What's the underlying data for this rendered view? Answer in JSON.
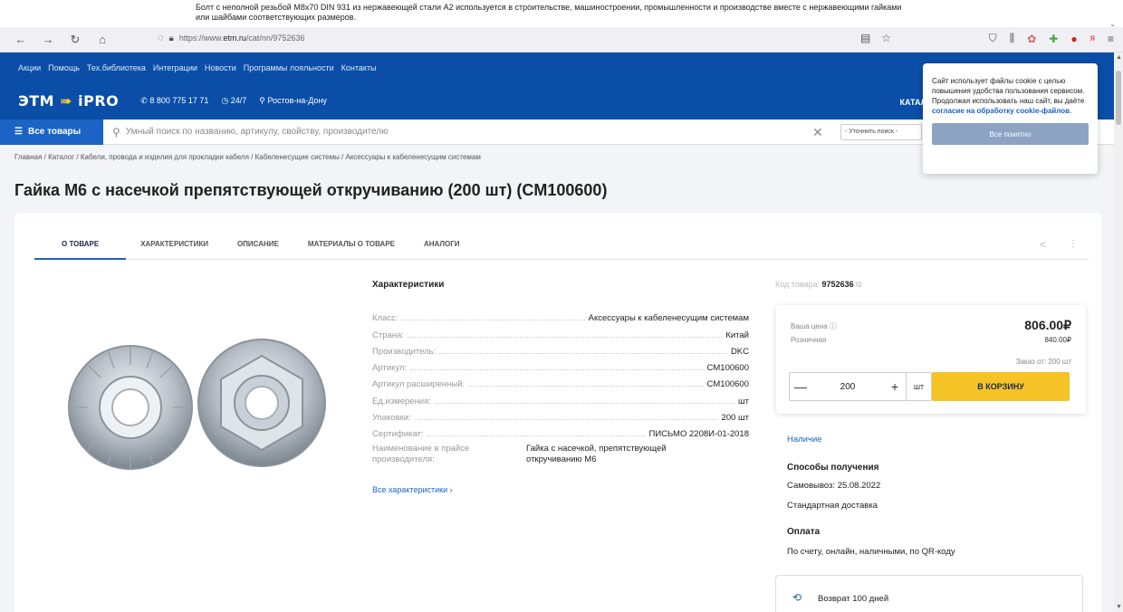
{
  "tooltip": {
    "line1": "Болт с неполной резьбой М8х70 DIN 931 из нержавеющей стали А2 используется в строительстве, машиностроении, промышленности и производстве вместе с нержавеющими гайками",
    "line2": "или шайбами соответствующих размеров."
  },
  "browser": {
    "url_prefix": "https://www.",
    "url_domain": "etm.ru",
    "url_path": "/cat/nn/9752636"
  },
  "topnav": {
    "links": [
      "Акции",
      "Помощь",
      "Тех.библиотека",
      "Интеграции",
      "Новости",
      "Программы лояльности",
      "Контакты"
    ]
  },
  "header": {
    "logo_a": "ЭТМ",
    "logo_b": "iPRO",
    "phone": "8 800 775 17 71",
    "hours": "24/7",
    "city": "Ростов-на-Дону",
    "catalog": "КАТАЛОГ"
  },
  "search": {
    "all_goods": "Все товары",
    "placeholder": "Умный поиск по названию, артикулу, свойству, производителю",
    "refine": "- Уточнить поиск -"
  },
  "cookie": {
    "text": "Сайт использует файлы cookie с целью повышения удобства пользования сервисом. Продолжая использовать наш сайт, вы даёте",
    "link": "согласие на обработку cookie-файлов",
    "dot": ".",
    "button": "Все понятно"
  },
  "breadcrumb": "Главная  /  Каталог  /  Кабели, провода и изделия для прокладки кабеля  /  Кабеленесущие системы  /  Аксессуары к кабеленесущим системам",
  "title": "Гайка М6 с насечкой препятствующей откручиванию (200 шт) (CM100600)",
  "tabs": [
    "О ТОВАРЕ",
    "ХАРАКТЕРИСТИКИ",
    "ОПИСАНИЕ",
    "МАТЕРИАЛЫ О ТОВАРЕ",
    "АНАЛОГИ"
  ],
  "specs": {
    "heading": "Характеристики",
    "rows": [
      {
        "k": "Класс:",
        "v": "Аксессуары к кабеленесущим системам"
      },
      {
        "k": "Страна:",
        "v": "Китай"
      },
      {
        "k": "Производитель:",
        "v": "DKC"
      },
      {
        "k": "Артикул:",
        "v": "CM100600"
      },
      {
        "k": "Артикул расширенный:",
        "v": "CM100600"
      },
      {
        "k": "Ед.измерения:",
        "v": "шт"
      },
      {
        "k": "Упаковки:",
        "v": "200 шт"
      },
      {
        "k": "Сертификат:",
        "v": "ПИСЬМО 2208И-01-2018"
      }
    ],
    "vendor_name_k": "Наименование в прайсе производителя:",
    "vendor_name_v": "Гайка с насечкой, препятствующей откручиванию М6",
    "all_link": "Все характеристики"
  },
  "product": {
    "code_label": "Код товара:",
    "code": "9752636",
    "price_label": "Ваша цена",
    "retail_label": "Розничная",
    "price": "806.00₽",
    "retail": "840.00₽",
    "min_order": "Заказ от: 200 шт",
    "qty": "200",
    "unit": "шт",
    "cart": "В КОРЗИНУ",
    "availability": "Наличие",
    "ways_title": "Способы получения",
    "pickup": "Самовывоз: 25.08.2022",
    "delivery": "Стандартная доставка",
    "pay_title": "Оплата",
    "pay": "По счету, онлайн, наличными, по QR-коду",
    "return": "Возврат 100 дней"
  }
}
